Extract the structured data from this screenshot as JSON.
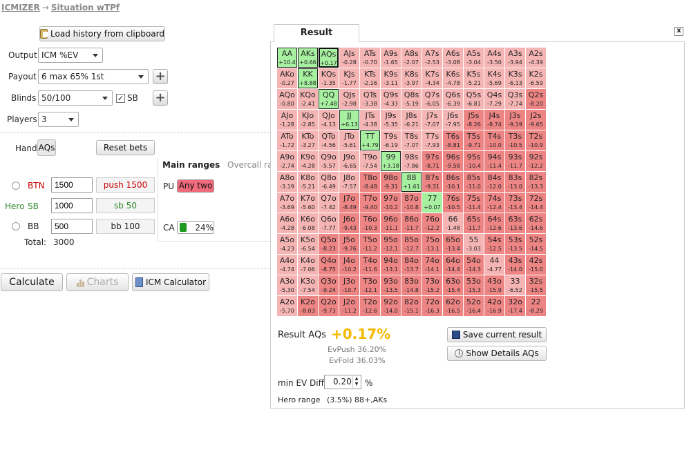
{
  "breadcrumb": {
    "home": "ICMIZER",
    "arrow": "→",
    "page": "Situation wTPf"
  },
  "toolbar": {
    "load_history": "Load history from clipboard"
  },
  "settings": {
    "output_label": "Output",
    "output_value": "ICM %EV",
    "payout_label": "Payout",
    "payout_value": "6 max 65% 1st",
    "blinds_label": "Blinds",
    "blinds_value": "50/100",
    "sb_label": "SB",
    "sb_checked": true,
    "players_label": "Players",
    "players_value": "3"
  },
  "hand": {
    "label": "Hand",
    "value": "AQs",
    "reset_bets": "Reset bets"
  },
  "players": [
    {
      "pos": "BTN",
      "stack": "1500",
      "bet": "push 1500",
      "color": "#cc0000",
      "hero": ""
    },
    {
      "pos": "SB",
      "stack": "1000",
      "bet": "sb 50",
      "color": "#2e8b2e",
      "hero": "Hero"
    },
    {
      "pos": "BB",
      "stack": "500",
      "bet": "bb 100",
      "color": "#222222",
      "hero": ""
    }
  ],
  "total": {
    "label": "Total:",
    "value": "3000"
  },
  "ranges": {
    "tab_main": "Main ranges",
    "tab_overcall": "Overcall ra",
    "pu_label": "PU",
    "pu_value": "Any two",
    "ca_label": "CA",
    "ca_value": "24%"
  },
  "actions": {
    "calculate": "Calculate",
    "charts": "Charts",
    "icm_calculator": "ICM Calculator"
  },
  "result": {
    "tab": "Result",
    "close": "x",
    "result_label": "Result AQs",
    "result_value": "+0.17%",
    "ev_push": "EvPush 36.20%",
    "ev_fold": "EvFold 36.03%",
    "save": "Save current result",
    "details": "Show Details AQs",
    "min_ev_label": "min EV Diff",
    "min_ev_value": "0.20",
    "min_ev_unit": "%",
    "hero_range_label": "Hero range",
    "hero_range_value": "(3.5%) 88+,AKs"
  },
  "colors": {
    "push": "#a6f0a0",
    "fold_light": "#f5b5b5",
    "fold_dark": "#ee8585",
    "accent": "#f5b800"
  },
  "grid": {
    "cells": [
      [
        "AA",
        "+10.4"
      ],
      [
        "AKs",
        "+0.66"
      ],
      [
        "AQs",
        "+0.17"
      ],
      [
        "AJs",
        "-0.28"
      ],
      [
        "ATs",
        "-0.70"
      ],
      [
        "A9s",
        "-1.65"
      ],
      [
        "A8s",
        "-2.07"
      ],
      [
        "A7s",
        "-2.53"
      ],
      [
        "A6s",
        "-3.08"
      ],
      [
        "A5s",
        "-3.04"
      ],
      [
        "A4s",
        "-3.50"
      ],
      [
        "A3s",
        "-3.94"
      ],
      [
        "A2s",
        "-4.39"
      ],
      [
        "AKo",
        "-0.27"
      ],
      [
        "KK",
        "+8.88"
      ],
      [
        "KQs",
        "-1.35"
      ],
      [
        "KJs",
        "-1.77"
      ],
      [
        "KTs",
        "-2.16"
      ],
      [
        "K9s",
        "-3.11"
      ],
      [
        "K8s",
        "-3.97"
      ],
      [
        "K7s",
        "-4.34"
      ],
      [
        "K6s",
        "-4.78"
      ],
      [
        "K5s",
        "-5.21"
      ],
      [
        "K4s",
        "-5.69"
      ],
      [
        "K3s",
        "-6.13"
      ],
      [
        "K2s",
        "-6.59"
      ],
      [
        "AQo",
        "-0.80"
      ],
      [
        "KQo",
        "-2.41"
      ],
      [
        "QQ",
        "+7.48"
      ],
      [
        "QJs",
        "-2.98"
      ],
      [
        "QTs",
        "-3.38"
      ],
      [
        "Q9s",
        "-4.33"
      ],
      [
        "Q8s",
        "-5.19"
      ],
      [
        "Q7s",
        "-6.05"
      ],
      [
        "Q6s",
        "-6.39"
      ],
      [
        "Q5s",
        "-6.81"
      ],
      [
        "Q4s",
        "-7.29"
      ],
      [
        "Q3s",
        "-7.74"
      ],
      [
        "Q2s",
        "-8.20"
      ],
      [
        "AJo",
        "-1.28"
      ],
      [
        "KJo",
        "-2.85"
      ],
      [
        "QJo",
        "-4.13"
      ],
      [
        "JJ",
        "+6.13"
      ],
      [
        "JTs",
        "-4.38"
      ],
      [
        "J9s",
        "-5.35"
      ],
      [
        "J8s",
        "-6.21"
      ],
      [
        "J7s",
        "-7.07"
      ],
      [
        "J6s",
        "-7.95"
      ],
      [
        "J5s",
        "-8.26"
      ],
      [
        "J4s",
        "-8.74"
      ],
      [
        "J3s",
        "-9.19"
      ],
      [
        "J2s",
        "-9.65"
      ],
      [
        "ATo",
        "-1.72"
      ],
      [
        "KTo",
        "-3.27"
      ],
      [
        "QTo",
        "-4.56"
      ],
      [
        "JTo",
        "-5.61"
      ],
      [
        "TT",
        "+4.79"
      ],
      [
        "T9s",
        "-6.19"
      ],
      [
        "T8s",
        "-7.07"
      ],
      [
        "T7s",
        "-7.93"
      ],
      [
        "T6s",
        "-8.81"
      ],
      [
        "T5s",
        "-9.71"
      ],
      [
        "T4s",
        "-10.0"
      ],
      [
        "T3s",
        "-10.5"
      ],
      [
        "T2s",
        "-10.9"
      ],
      [
        "A9o",
        "-2.74"
      ],
      [
        "K9o",
        "-4.28"
      ],
      [
        "Q9o",
        "-5.57"
      ],
      [
        "J9o",
        "-6.65"
      ],
      [
        "T9o",
        "-7.54"
      ],
      [
        "99",
        "+3.18"
      ],
      [
        "98s",
        "-7.86"
      ],
      [
        "97s",
        "-8.71"
      ],
      [
        "96s",
        "-9.58"
      ],
      [
        "95s",
        "-10.4"
      ],
      [
        "94s",
        "-11.4"
      ],
      [
        "93s",
        "-11.7"
      ],
      [
        "92s",
        "-12.2"
      ],
      [
        "A8o",
        "-3.19"
      ],
      [
        "K8o",
        "-5.21"
      ],
      [
        "Q8o",
        "-6.49"
      ],
      [
        "J8o",
        "-7.57"
      ],
      [
        "T8o",
        "-8.48"
      ],
      [
        "98o",
        "-9.31"
      ],
      [
        "88",
        "+1.61"
      ],
      [
        "87s",
        "-9.31"
      ],
      [
        "86s",
        "-10.1"
      ],
      [
        "85s",
        "-11.0"
      ],
      [
        "84s",
        "-12.0"
      ],
      [
        "83s",
        "-13.0"
      ],
      [
        "82s",
        "-13.3"
      ],
      [
        "A7o",
        "-3.69"
      ],
      [
        "K7o",
        "-5.60"
      ],
      [
        "Q7o",
        "-7.42"
      ],
      [
        "J7o",
        "-8.49"
      ],
      [
        "T7o",
        "-9.40"
      ],
      [
        "97o",
        "-10.2"
      ],
      [
        "87o",
        "-10.8"
      ],
      [
        "77",
        "+0.07"
      ],
      [
        "76s",
        "-10.5"
      ],
      [
        "75s",
        "-11.4"
      ],
      [
        "74s",
        "-12.4"
      ],
      [
        "73s",
        "-13.4"
      ],
      [
        "72s",
        "-14.4"
      ],
      [
        "A6o",
        "-4.28"
      ],
      [
        "K6o",
        "-6.08"
      ],
      [
        "Q6o",
        "-7.77"
      ],
      [
        "J6o",
        "-9.43"
      ],
      [
        "T6o",
        "-10.3"
      ],
      [
        "96o",
        "-11.1"
      ],
      [
        "86o",
        "-11.7"
      ],
      [
        "76o",
        "-12.2"
      ],
      [
        "66",
        "-1.48"
      ],
      [
        "65s",
        "-11.7"
      ],
      [
        "64s",
        "-12.6"
      ],
      [
        "63s",
        "-13.6"
      ],
      [
        "62s",
        "-14.6"
      ],
      [
        "A5o",
        "-4.23"
      ],
      [
        "K5o",
        "-6.54"
      ],
      [
        "Q5o",
        "-8.23"
      ],
      [
        "J5o",
        "-9.76"
      ],
      [
        "T5o",
        "-11.2"
      ],
      [
        "95o",
        "-12.1"
      ],
      [
        "85o",
        "-12.7"
      ],
      [
        "75o",
        "-13.1"
      ],
      [
        "65o",
        "-13.4"
      ],
      [
        "55",
        "-3.03"
      ],
      [
        "54s",
        "-12.5"
      ],
      [
        "53s",
        "-13.5"
      ],
      [
        "52s",
        "-14.5"
      ],
      [
        "A4o",
        "-4.74"
      ],
      [
        "K4o",
        "-7.06"
      ],
      [
        "Q4o",
        "-8.75"
      ],
      [
        "J4o",
        "-10.2"
      ],
      [
        "T4o",
        "-11.6"
      ],
      [
        "94o",
        "-13.1"
      ],
      [
        "84o",
        "-13.7"
      ],
      [
        "74o",
        "-14.1"
      ],
      [
        "64o",
        "-14.4"
      ],
      [
        "54o",
        "-14.3"
      ],
      [
        "44",
        "-4.77"
      ],
      [
        "43s",
        "-14.0"
      ],
      [
        "42s",
        "-15.0"
      ],
      [
        "A3o",
        "-5.30"
      ],
      [
        "K3o",
        "-7.54"
      ],
      [
        "Q3o",
        "-9.24"
      ],
      [
        "J3o",
        "-10.7"
      ],
      [
        "T3o",
        "-12.1"
      ],
      [
        "93o",
        "-13.5"
      ],
      [
        "83o",
        "-14.8"
      ],
      [
        "73o",
        "-15.2"
      ],
      [
        "63o",
        "-15.4"
      ],
      [
        "53o",
        "-15.3"
      ],
      [
        "43o",
        "-15.9"
      ],
      [
        "33",
        "-6.52"
      ],
      [
        "32s",
        "-15.5"
      ],
      [
        "A2o",
        "-5.70"
      ],
      [
        "K2o",
        "-8.03"
      ],
      [
        "Q2o",
        "-9.73"
      ],
      [
        "J2o",
        "-11.2"
      ],
      [
        "T2o",
        "-12.6"
      ],
      [
        "92o",
        "-14.0"
      ],
      [
        "82o",
        "-15.1"
      ],
      [
        "72o",
        "-16.3"
      ],
      [
        "62o",
        "-16.5"
      ],
      [
        "52o",
        "-16.4"
      ],
      [
        "42o",
        "-16.9"
      ],
      [
        "32o",
        "-17.4"
      ],
      [
        "22",
        "-8.29"
      ]
    ]
  }
}
